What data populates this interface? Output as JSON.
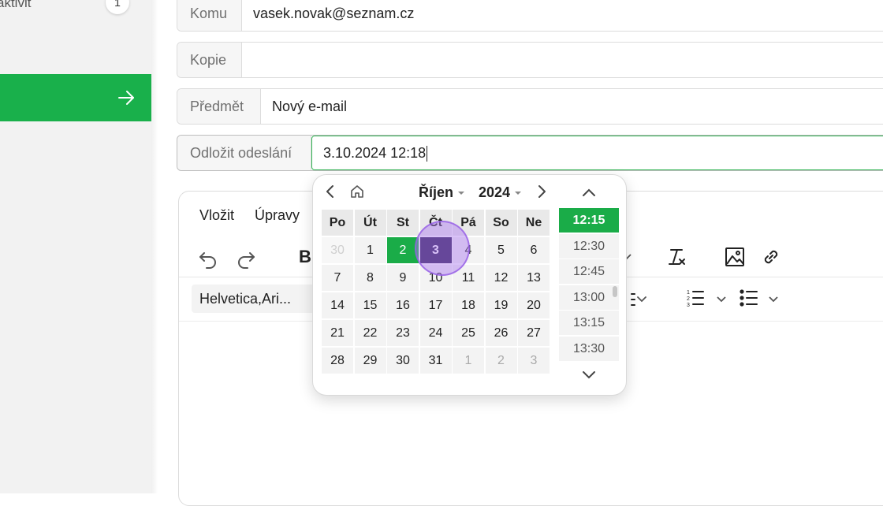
{
  "sidebar": {
    "activities_label": "aktivit",
    "activities_count": "1"
  },
  "fields": {
    "to": {
      "label": "Komu",
      "value": "vasek.novak@seznam.cz"
    },
    "cc": {
      "label": "Kopie",
      "value": ""
    },
    "subject": {
      "label": "Předmět",
      "value": "Nový e-mail"
    },
    "delay": {
      "label": "Odložit odeslání",
      "value": "3.10.2024 12:18"
    }
  },
  "editor": {
    "menu": [
      "Vložit",
      "Úpravy"
    ],
    "font": "Helvetica,Ari...",
    "bold_label": "B"
  },
  "calendar": {
    "month": "Říjen",
    "year": "2024",
    "weekdays": [
      "Po",
      "Út",
      "St",
      "Čt",
      "Pá",
      "So",
      "Ne"
    ],
    "weeks": [
      [
        "30",
        "1",
        "2",
        "3",
        "4",
        "5",
        "6"
      ],
      [
        "7",
        "8",
        "9",
        "10",
        "11",
        "12",
        "13"
      ],
      [
        "14",
        "15",
        "16",
        "17",
        "18",
        "19",
        "20"
      ],
      [
        "21",
        "22",
        "23",
        "24",
        "25",
        "26",
        "27"
      ],
      [
        "28",
        "29",
        "30",
        "31",
        "1",
        "2",
        "3"
      ]
    ],
    "today": "2",
    "selected": "3",
    "times": [
      "12:15",
      "12:30",
      "12:45",
      "13:00",
      "13:15",
      "13:30"
    ],
    "selected_time": "12:15"
  },
  "colors": {
    "accent_green": "#19b04b",
    "selected_day": "#2e1f55",
    "click_indicator": "#aa78f0"
  }
}
